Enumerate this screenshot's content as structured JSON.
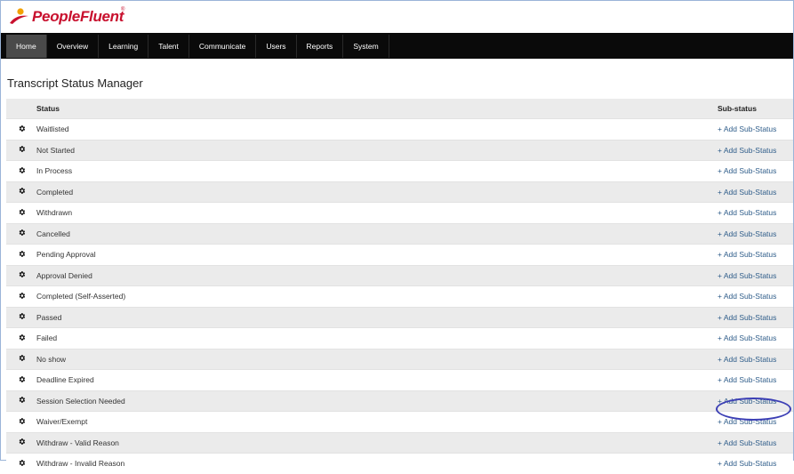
{
  "brand": {
    "name": "PeopleFluent",
    "trademark": "®"
  },
  "nav": {
    "items": [
      {
        "label": "Home",
        "active": true
      },
      {
        "label": "Overview"
      },
      {
        "label": "Learning"
      },
      {
        "label": "Talent"
      },
      {
        "label": "Communicate"
      },
      {
        "label": "Users"
      },
      {
        "label": "Reports"
      },
      {
        "label": "System"
      }
    ]
  },
  "page": {
    "title": "Transcript Status Manager"
  },
  "table": {
    "columns": {
      "status": "Status",
      "substatus": "Sub-status"
    },
    "link_label": "+ Add Sub-Status",
    "rows": [
      "Waitlisted",
      "Not Started",
      "In Process",
      "Completed",
      "Withdrawn",
      "Cancelled",
      "Pending Approval",
      "Approval Denied",
      "Completed (Self-Asserted)",
      "Passed",
      "Failed",
      "No show",
      "Deadline Expired",
      "Session Selection Needed",
      "Waiver/Exempt",
      "Withdraw - Valid Reason",
      "Withdraw - Invalid Reason"
    ],
    "highlighted_row": 14,
    "row_icon": "gear-icon"
  },
  "colors": {
    "brand_red": "#c8102e",
    "nav_bg": "#0a0a0a",
    "link": "#2f5d8a",
    "highlight_ring": "#3c3fb5"
  }
}
